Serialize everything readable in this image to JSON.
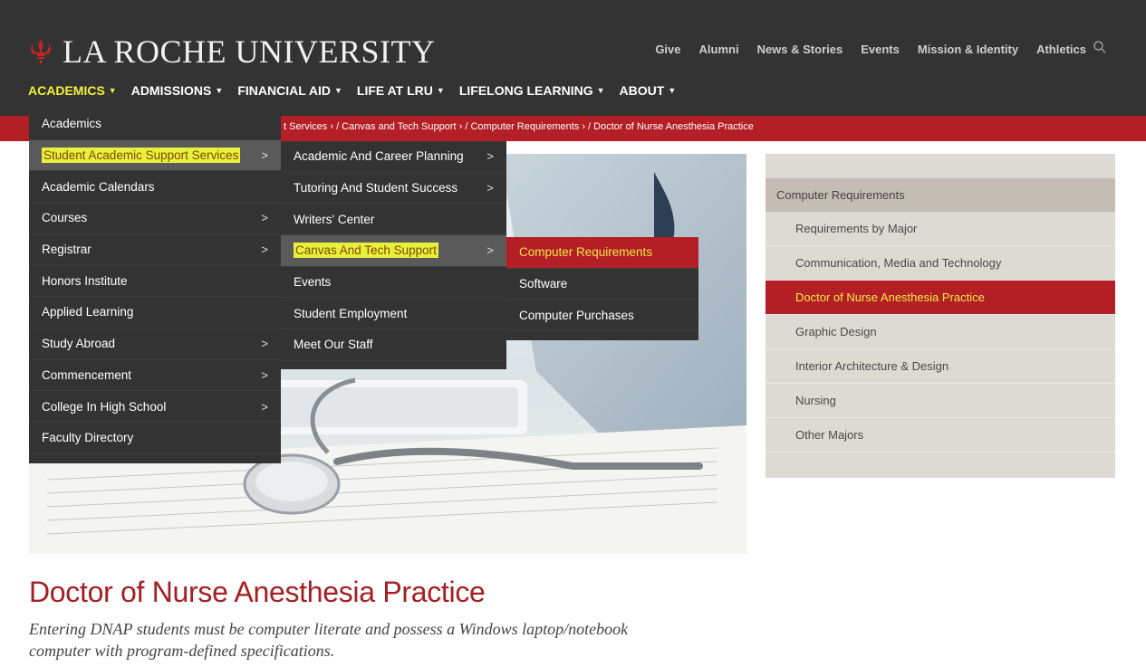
{
  "brand": {
    "name": "LA ROCHE UNIVERSITY",
    "accent": "#b31f24",
    "dark": "#333333",
    "highlight": "#f4f23a"
  },
  "utility_nav": [
    "Give",
    "Alumni",
    "News & Stories",
    "Events",
    "Mission & Identity",
    "Athletics"
  ],
  "main_nav": [
    {
      "label": "ACADEMICS"
    },
    {
      "label": "ADMISSIONS"
    },
    {
      "label": "FINANCIAL AID"
    },
    {
      "label": "LIFE AT LRU"
    },
    {
      "label": "LIFELONG LEARNING"
    },
    {
      "label": "ABOUT"
    }
  ],
  "breadcrumb": "t Services › / Canvas and Tech Support › / Computer Requirements › / Doctor of Nurse Anesthesia Practice",
  "menu_academics": [
    {
      "label": "Academics",
      "has_sub": false
    },
    {
      "label": "Student Academic Support Services",
      "has_sub": true
    },
    {
      "label": "Academic Calendars",
      "has_sub": false
    },
    {
      "label": "Courses",
      "has_sub": true
    },
    {
      "label": "Registrar",
      "has_sub": true
    },
    {
      "label": "Honors Institute",
      "has_sub": false
    },
    {
      "label": "Applied Learning",
      "has_sub": false
    },
    {
      "label": "Study Abroad",
      "has_sub": true
    },
    {
      "label": "Commencement",
      "has_sub": true
    },
    {
      "label": "College In High School",
      "has_sub": true
    },
    {
      "label": "Faculty Directory",
      "has_sub": false
    }
  ],
  "menu_support": [
    {
      "label": "Academic And Career Planning",
      "has_sub": true
    },
    {
      "label": "Tutoring And Student Success",
      "has_sub": true
    },
    {
      "label": "Writers' Center",
      "has_sub": false
    },
    {
      "label": "Canvas And Tech Support",
      "has_sub": true
    },
    {
      "label": "Events",
      "has_sub": false
    },
    {
      "label": "Student Employment",
      "has_sub": false
    },
    {
      "label": "Meet Our Staff",
      "has_sub": false
    }
  ],
  "menu_canvas": [
    {
      "label": "Computer Requirements"
    },
    {
      "label": "Software"
    },
    {
      "label": "Computer Purchases"
    }
  ],
  "sidebar": {
    "heading": "Computer Requirements",
    "items": [
      "Requirements by Major",
      "Communication, Media and Technology",
      "Doctor of Nurse Anesthesia Practice",
      "Graphic Design",
      "Interior Architecture & Design",
      "Nursing",
      "Other Majors"
    ]
  },
  "page": {
    "title": "Doctor of Nurse Anesthesia Practice",
    "intro": "Entering DNAP students must be computer literate and possess a Windows laptop/notebook computer with program-defined specifications."
  }
}
